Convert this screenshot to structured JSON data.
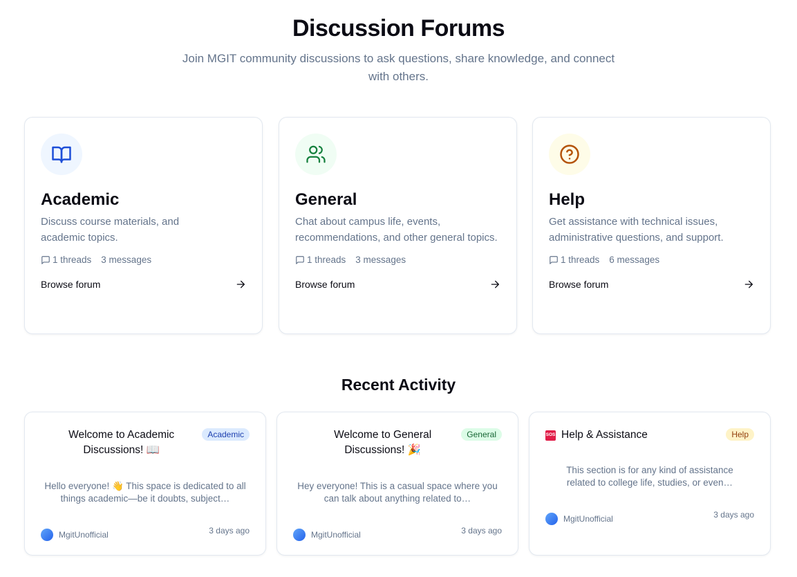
{
  "header": {
    "title": "Discussion Forums",
    "subtitle": "Join MGIT community discussions to ask questions, share knowledge, and connect with others."
  },
  "forums": [
    {
      "name": "Academic",
      "icon": "book-open-icon",
      "icon_color": "#1d4ed8",
      "icon_bg": "#eff6ff",
      "description": "Discuss course materials, and academic topics.",
      "threads": "1 threads",
      "messages": "3 messages",
      "browse_label": "Browse forum"
    },
    {
      "name": "General",
      "icon": "users-icon",
      "icon_color": "#15803d",
      "icon_bg": "#f0fdf4",
      "description": "Chat about campus life, events, recommendations, and other general topics.",
      "threads": "1 threads",
      "messages": "3 messages",
      "browse_label": "Browse forum"
    },
    {
      "name": "Help",
      "icon": "help-circle-icon",
      "icon_color": "#b45309",
      "icon_bg": "#fefce8",
      "description": "Get assistance with technical issues, administrative questions, and support.",
      "threads": "1 threads",
      "messages": "6 messages",
      "browse_label": "Browse forum"
    }
  ],
  "recent_activity": {
    "title": "Recent Activity",
    "items": [
      {
        "title": "Welcome to Academic Discussions! 📖",
        "badge": "Academic",
        "badge_bg": "#dbeafe",
        "badge_color": "#1e40af",
        "excerpt": "Hello everyone! 👋 This space is dedicated to all things academic—be it doubts, subject…",
        "author": "MgitUnofficial",
        "time": "3 days ago"
      },
      {
        "title": "Welcome to General Discussions! 🎉",
        "badge": "General",
        "badge_bg": "#dcfce7",
        "badge_color": "#166534",
        "excerpt": "Hey everyone! This is a casual space where you can talk about anything related to…",
        "author": "MgitUnofficial",
        "time": "3 days ago"
      },
      {
        "title": "Help & Assistance",
        "title_icon": "sos-icon",
        "badge": "Help",
        "badge_bg": "#fef3c7",
        "badge_color": "#92400e",
        "excerpt": "This section is for any kind of assistance related to college life, studies, or even…",
        "author": "MgitUnofficial",
        "time": "3 days ago"
      }
    ]
  }
}
